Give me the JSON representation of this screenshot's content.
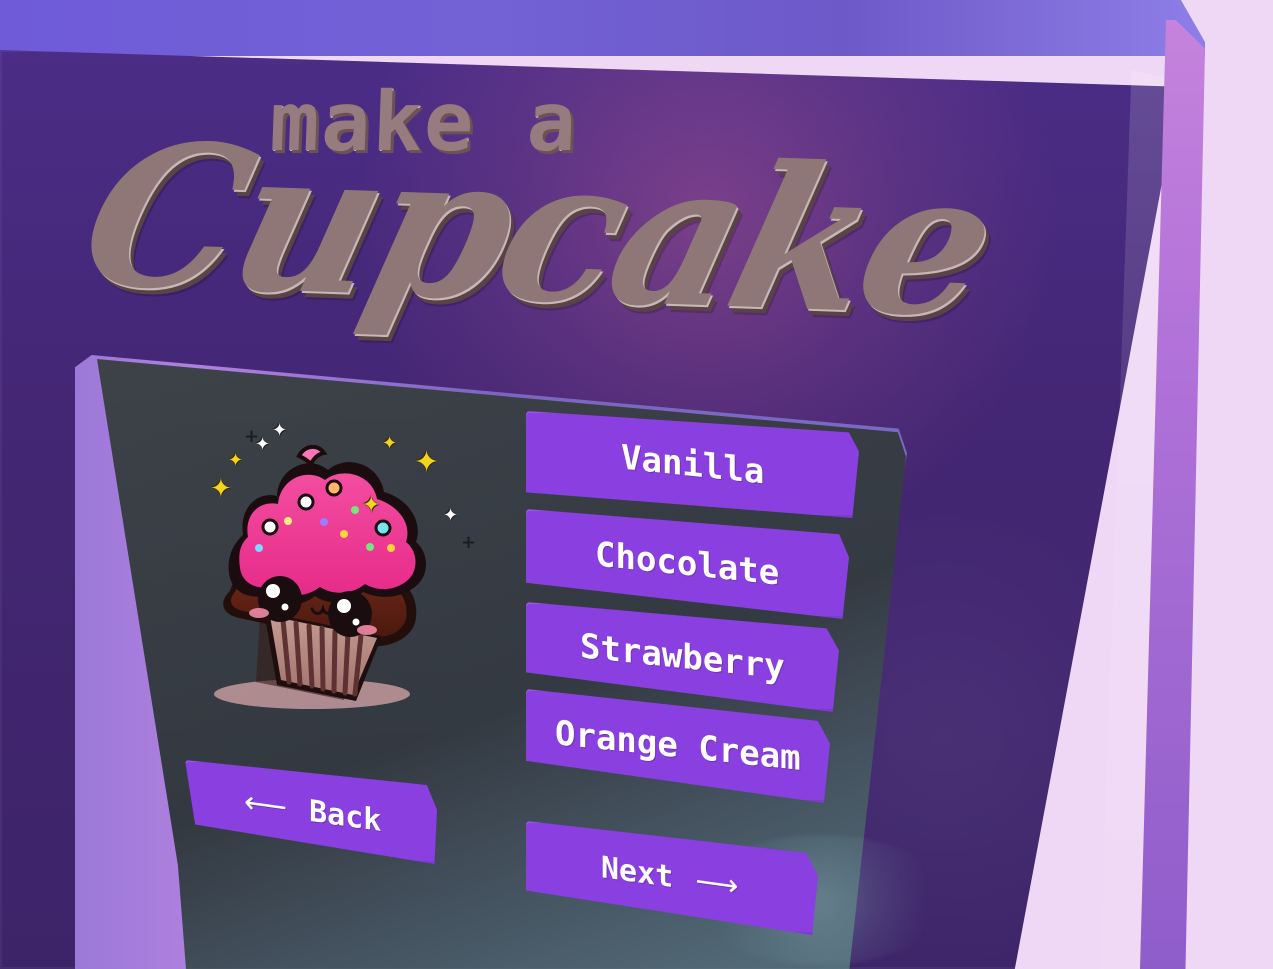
{
  "title": {
    "small": "make a",
    "large": "Cupcake"
  },
  "flavors": [
    {
      "label": "Vanilla"
    },
    {
      "label": "Chocolate"
    },
    {
      "label": "Strawberry"
    },
    {
      "label": "Orange Cream"
    }
  ],
  "navigation": {
    "back_label": "Back",
    "next_label": "Next",
    "back_arrow": "⟵",
    "next_arrow": "⟶"
  },
  "icons": {
    "cupcake": "cupcake-illustration",
    "sparkles": "sparkle-icon"
  },
  "colors": {
    "accent": "#8a3fe0",
    "panel": "#323840",
    "frame": "#7c65c2",
    "background": "#432674",
    "title": "#8f7777"
  }
}
